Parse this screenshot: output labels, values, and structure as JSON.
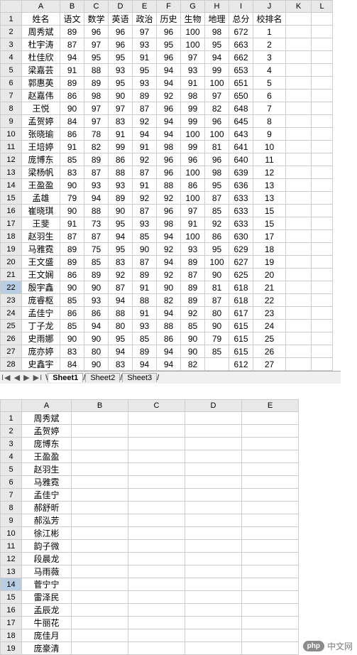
{
  "top": {
    "columns": [
      "A",
      "B",
      "C",
      "D",
      "E",
      "F",
      "G",
      "H",
      "I",
      "J",
      "K",
      "L"
    ],
    "headerRow": [
      "姓名",
      "语文",
      "数学",
      "英语",
      "政治",
      "历史",
      "生物",
      "地理",
      "总分",
      "校排名",
      "",
      ""
    ],
    "selectedRowHeader": 22,
    "rows": [
      {
        "n": 2,
        "c": [
          "周秀斌",
          "89",
          "96",
          "96",
          "97",
          "96",
          "100",
          "98",
          "672",
          "1"
        ]
      },
      {
        "n": 3,
        "c": [
          "杜宇涛",
          "87",
          "97",
          "96",
          "93",
          "95",
          "100",
          "95",
          "663",
          "2"
        ]
      },
      {
        "n": 4,
        "c": [
          "杜佳欣",
          "94",
          "95",
          "95",
          "91",
          "96",
          "97",
          "94",
          "662",
          "3"
        ]
      },
      {
        "n": 5,
        "c": [
          "梁嘉芸",
          "91",
          "88",
          "93",
          "95",
          "94",
          "93",
          "99",
          "653",
          "4"
        ]
      },
      {
        "n": 6,
        "c": [
          "郭惠英",
          "89",
          "89",
          "95",
          "93",
          "94",
          "91",
          "100",
          "651",
          "5"
        ]
      },
      {
        "n": 7,
        "c": [
          "赵嘉伟",
          "86",
          "98",
          "90",
          "89",
          "92",
          "98",
          "97",
          "650",
          "6"
        ]
      },
      {
        "n": 8,
        "c": [
          "王悦",
          "90",
          "97",
          "97",
          "87",
          "96",
          "99",
          "82",
          "648",
          "7"
        ]
      },
      {
        "n": 9,
        "c": [
          "孟贺婷",
          "84",
          "97",
          "83",
          "92",
          "94",
          "99",
          "96",
          "645",
          "8"
        ]
      },
      {
        "n": 10,
        "c": [
          "张晓瑜",
          "86",
          "78",
          "91",
          "94",
          "94",
          "100",
          "100",
          "643",
          "9"
        ]
      },
      {
        "n": 11,
        "c": [
          "王培婷",
          "91",
          "82",
          "99",
          "91",
          "98",
          "99",
          "81",
          "641",
          "10"
        ]
      },
      {
        "n": 12,
        "c": [
          "庞博东",
          "85",
          "89",
          "86",
          "92",
          "96",
          "96",
          "96",
          "640",
          "11"
        ]
      },
      {
        "n": 13,
        "c": [
          "梁杨帆",
          "83",
          "87",
          "88",
          "87",
          "96",
          "100",
          "98",
          "639",
          "12"
        ]
      },
      {
        "n": 14,
        "c": [
          "王盈盈",
          "90",
          "93",
          "93",
          "91",
          "88",
          "86",
          "95",
          "636",
          "13"
        ]
      },
      {
        "n": 15,
        "c": [
          "孟雄",
          "79",
          "94",
          "89",
          "92",
          "92",
          "100",
          "87",
          "633",
          "13"
        ]
      },
      {
        "n": 16,
        "c": [
          "崔晓琪",
          "90",
          "88",
          "90",
          "87",
          "96",
          "97",
          "85",
          "633",
          "15"
        ]
      },
      {
        "n": 17,
        "c": [
          "王斐",
          "91",
          "73",
          "95",
          "93",
          "98",
          "91",
          "92",
          "633",
          "15"
        ]
      },
      {
        "n": 18,
        "c": [
          "赵羽生",
          "87",
          "87",
          "94",
          "85",
          "94",
          "100",
          "86",
          "630",
          "17"
        ]
      },
      {
        "n": 19,
        "c": [
          "马雅霓",
          "89",
          "75",
          "95",
          "90",
          "92",
          "93",
          "95",
          "629",
          "18"
        ]
      },
      {
        "n": 20,
        "c": [
          "王文盛",
          "89",
          "85",
          "83",
          "87",
          "94",
          "89",
          "100",
          "627",
          "19"
        ]
      },
      {
        "n": 21,
        "c": [
          "王文娴",
          "86",
          "89",
          "92",
          "89",
          "92",
          "87",
          "90",
          "625",
          "20"
        ]
      },
      {
        "n": 22,
        "c": [
          "殷宇鑫",
          "90",
          "90",
          "87",
          "91",
          "90",
          "89",
          "81",
          "618",
          "21"
        ]
      },
      {
        "n": 23,
        "c": [
          "庞睿枢",
          "85",
          "93",
          "94",
          "88",
          "82",
          "89",
          "87",
          "618",
          "22"
        ]
      },
      {
        "n": 24,
        "c": [
          "孟佳宁",
          "86",
          "86",
          "88",
          "91",
          "94",
          "92",
          "80",
          "617",
          "23"
        ]
      },
      {
        "n": 25,
        "c": [
          "丁子龙",
          "85",
          "94",
          "80",
          "93",
          "88",
          "85",
          "90",
          "615",
          "24"
        ]
      },
      {
        "n": 26,
        "c": [
          "史雨娜",
          "90",
          "90",
          "95",
          "85",
          "86",
          "90",
          "79",
          "615",
          "25"
        ]
      },
      {
        "n": 27,
        "c": [
          "庞亦婷",
          "83",
          "80",
          "94",
          "89",
          "94",
          "90",
          "85",
          "615",
          "26"
        ]
      },
      {
        "n": 28,
        "c": [
          "史鑫宇",
          "84",
          "90",
          "83",
          "94",
          "94",
          "82",
          "",
          "612",
          "27"
        ]
      }
    ]
  },
  "tabs": {
    "nav": "I◀ ◀ ▶ ▶I",
    "items": [
      "Sheet1",
      "Sheet2",
      "Sheet3"
    ],
    "active": 0
  },
  "bottom": {
    "columns": [
      "A",
      "B",
      "C",
      "D",
      "E"
    ],
    "selectedRowHeader": 14,
    "rows": [
      {
        "n": 1,
        "c": [
          "周秀斌"
        ]
      },
      {
        "n": 2,
        "c": [
          "孟贺婷"
        ]
      },
      {
        "n": 3,
        "c": [
          "庞博东"
        ]
      },
      {
        "n": 4,
        "c": [
          "王盈盈"
        ]
      },
      {
        "n": 5,
        "c": [
          "赵羽生"
        ]
      },
      {
        "n": 6,
        "c": [
          "马雅霓"
        ]
      },
      {
        "n": 7,
        "c": [
          "孟佳宁"
        ]
      },
      {
        "n": 8,
        "c": [
          "郝舒昕"
        ]
      },
      {
        "n": 9,
        "c": [
          "郝泓芳"
        ]
      },
      {
        "n": 10,
        "c": [
          "徐江彬"
        ]
      },
      {
        "n": 11,
        "c": [
          "韵子微"
        ]
      },
      {
        "n": 12,
        "c": [
          "段晨龙"
        ]
      },
      {
        "n": 13,
        "c": [
          "马雨薇"
        ]
      },
      {
        "n": 14,
        "c": [
          "菅宁宁"
        ]
      },
      {
        "n": 15,
        "c": [
          "雷泽民"
        ]
      },
      {
        "n": 16,
        "c": [
          "孟辰龙"
        ]
      },
      {
        "n": 17,
        "c": [
          "牛丽花"
        ]
      },
      {
        "n": 18,
        "c": [
          "庞佳月"
        ]
      },
      {
        "n": 19,
        "c": [
          "庞豪清"
        ]
      }
    ]
  },
  "watermark": {
    "badge": "php",
    "text": "中文网"
  }
}
